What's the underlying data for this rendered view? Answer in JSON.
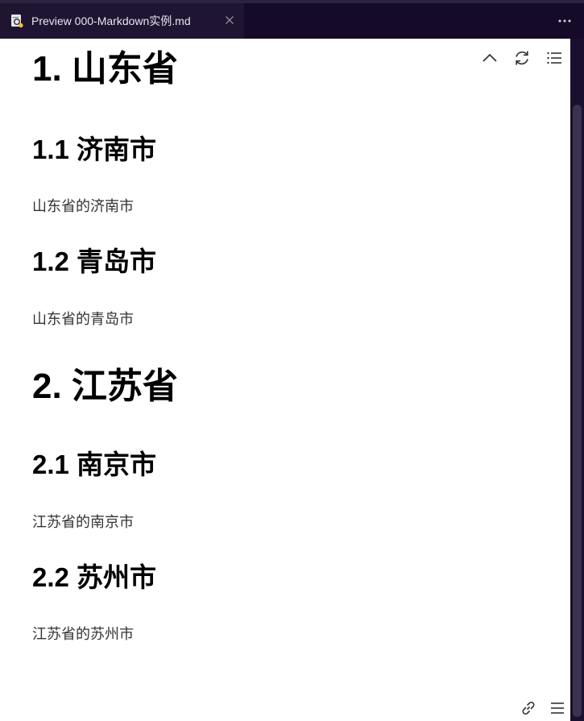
{
  "tab": {
    "title": "Preview 000-Markdown实例.md"
  },
  "doc": {
    "h1_a": "1. 山东省",
    "h2_a1": "1.1 济南市",
    "p_a1": "山东省的济南市",
    "h2_a2": "1.2 青岛市",
    "p_a2": "山东省的青岛市",
    "h1_b": "2. 江苏省",
    "h2_b1": "2.1 南京市",
    "p_b1": "江苏省的南京市",
    "h2_b2": "2.2 苏州市",
    "p_b2": "江苏省的苏州市"
  },
  "icons": {
    "tab_icon": "preview-file-icon",
    "close": "close-icon",
    "more": "more-icon",
    "scroll_top": "chevron-up-icon",
    "refresh": "refresh-icon",
    "toc": "list-icon",
    "link": "link-icon",
    "menu": "hamburger-icon"
  },
  "colors": {
    "titlebar": "#150b28",
    "tab_active": "#1f1533",
    "content_bg": "#ffffff"
  }
}
